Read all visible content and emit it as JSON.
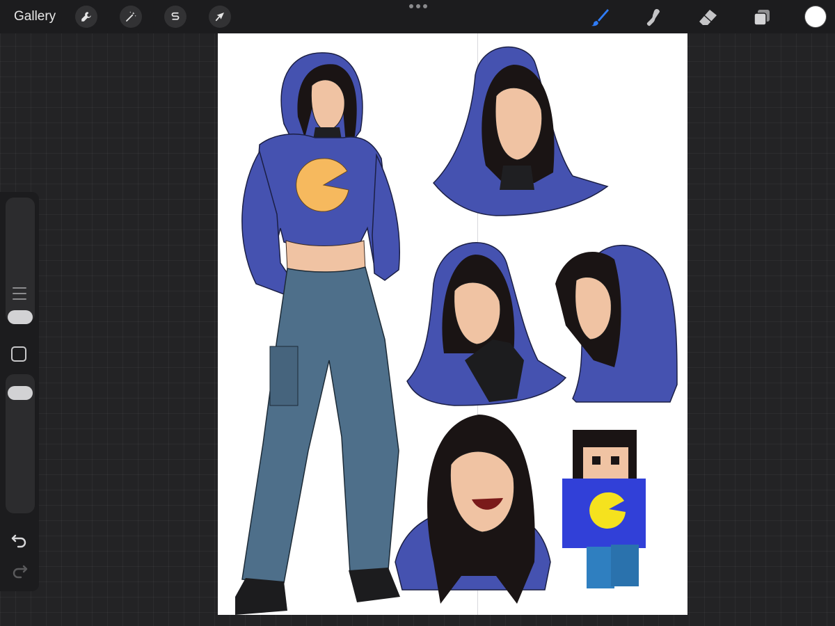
{
  "toolbar": {
    "gallery_label": "Gallery",
    "left_tools": [
      {
        "name": "actions",
        "icon": "wrench-icon"
      },
      {
        "name": "adjustments",
        "icon": "magic-wand-icon"
      },
      {
        "name": "selection",
        "icon": "selection-s-icon"
      },
      {
        "name": "transform",
        "icon": "arrow-cursor-icon"
      }
    ],
    "right_tools": [
      {
        "name": "brush",
        "icon": "brush-icon",
        "active": true
      },
      {
        "name": "smudge",
        "icon": "smudge-finger-icon"
      },
      {
        "name": "eraser",
        "icon": "eraser-icon"
      },
      {
        "name": "layers",
        "icon": "layers-icon"
      }
    ],
    "active_color": "#ffffff",
    "accent_color": "#2f7cf6"
  },
  "sidebar": {
    "brush_size_level": 0.1,
    "brush_opacity_level": 0.93
  },
  "colors": {
    "hoodie": "#4552b0",
    "pants": "#4e6f8a",
    "skin": "#f0c3a3",
    "hair": "#1a1414",
    "pacman": "#f6b95e",
    "minecraft_shirt": "#3140d8",
    "minecraft_pacman": "#f5e21e"
  }
}
